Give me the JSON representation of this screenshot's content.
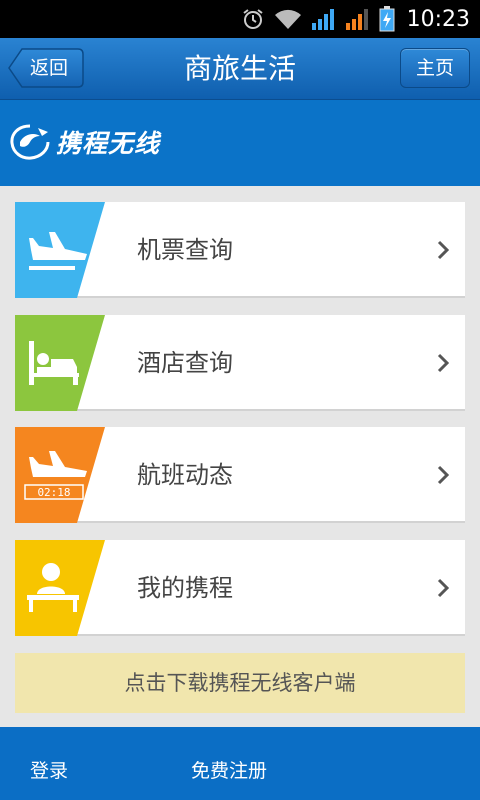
{
  "status_bar": {
    "time": "10:23"
  },
  "title_bar": {
    "back_label": "返回",
    "title": "商旅生活",
    "home_label": "主页"
  },
  "brand": {
    "name": "携程无线"
  },
  "menu": [
    {
      "label": "机票查询",
      "icon": "airplane-departure-icon",
      "color": "#3eb4ee"
    },
    {
      "label": "酒店查询",
      "icon": "hotel-bed-icon",
      "color": "#8cc63e"
    },
    {
      "label": "航班动态",
      "icon": "flight-status-icon",
      "color": "#f5861f",
      "icon_text": "02:18"
    },
    {
      "label": "我的携程",
      "icon": "user-desk-icon",
      "color": "#f7c500"
    }
  ],
  "download_banner": "点击下载携程无线客户端",
  "bottom_bar": {
    "login_label": "登录",
    "register_label": "免费注册"
  }
}
